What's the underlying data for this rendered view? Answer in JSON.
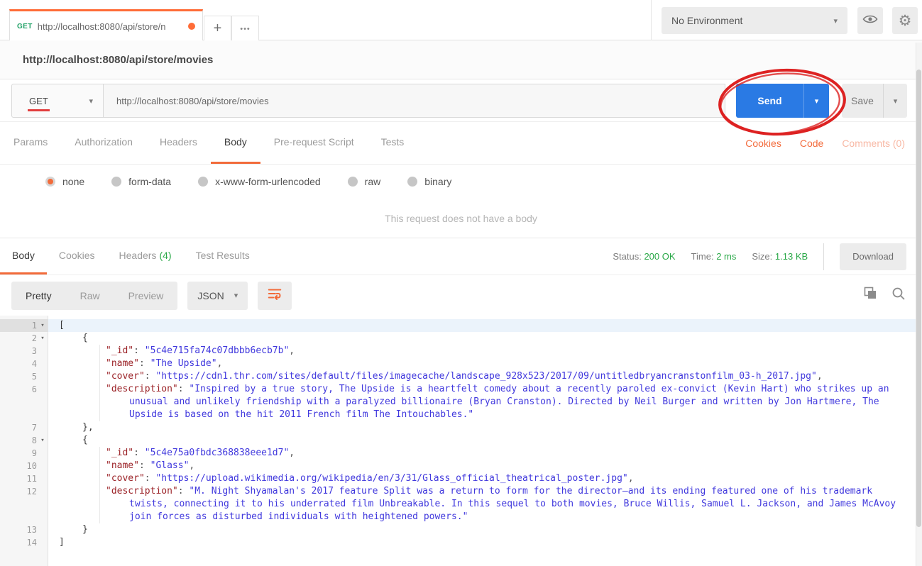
{
  "header": {
    "tab": {
      "method": "GET",
      "url": "http://localhost:8080/api/store/n"
    },
    "new_tab_label": "+",
    "more_tabs_label": "•••",
    "environment_label": "No Environment"
  },
  "request_title": "http://localhost:8080/api/store/movies",
  "request_builder": {
    "method": "GET",
    "url_value": "http://localhost:8080/api/store/movies",
    "send_label": "Send",
    "save_label": "Save"
  },
  "annotation": {
    "shape": "hand-drawn-ellipse",
    "color": "#dd2222",
    "target": "send-button"
  },
  "request_tabs": {
    "items": [
      "Params",
      "Authorization",
      "Headers",
      "Body",
      "Pre-request Script",
      "Tests"
    ],
    "active": "Body",
    "cookies_link": "Cookies",
    "code_link": "Code",
    "comments_link": "Comments (0)"
  },
  "body_type_options": [
    {
      "label": "none",
      "selected": true
    },
    {
      "label": "form-data",
      "selected": false
    },
    {
      "label": "x-www-form-urlencoded",
      "selected": false
    },
    {
      "label": "raw",
      "selected": false
    },
    {
      "label": "binary",
      "selected": false
    }
  ],
  "empty_body_message": "This request does not have a body",
  "response": {
    "tabs": {
      "body": "Body",
      "cookies": "Cookies",
      "headers": "Headers",
      "headers_count": "(4)",
      "test_results": "Test Results"
    },
    "active_tab": "Body",
    "meta": {
      "status_label": "Status:",
      "status_value": "200 OK",
      "time_label": "Time:",
      "time_value": "2 ms",
      "size_label": "Size:",
      "size_value": "1.13 KB"
    },
    "download_label": "Download",
    "view_modes": {
      "pretty": "Pretty",
      "raw": "Raw",
      "preview": "Preview"
    },
    "active_view": "Pretty",
    "format": "JSON"
  },
  "colors": {
    "accent_orange": "#ff6c37",
    "send_blue": "#2a7ae4",
    "method_green": "#23a268",
    "status_green": "#29a847",
    "link_orange": "#f36c3d",
    "annotation_red": "#dd2222",
    "json_key": "#9b2227",
    "json_string": "#4038dd"
  },
  "response_body": {
    "lines": [
      {
        "num": "1",
        "fold": true,
        "sel": true,
        "indent": 0,
        "parts": [
          {
            "c": "brk",
            "t": "["
          }
        ]
      },
      {
        "num": "2",
        "fold": true,
        "indent": 1,
        "parts": [
          {
            "c": "brk",
            "t": "{"
          }
        ]
      },
      {
        "num": "3",
        "indent": 2,
        "parts": [
          {
            "c": "key",
            "t": "\"_id\""
          },
          {
            "c": "pun",
            "t": ": "
          },
          {
            "c": "str",
            "t": "\"5c4e715fa74c07dbbb6ecb7b\""
          },
          {
            "c": "pun",
            "t": ","
          }
        ]
      },
      {
        "num": "4",
        "indent": 2,
        "parts": [
          {
            "c": "key",
            "t": "\"name\""
          },
          {
            "c": "pun",
            "t": ": "
          },
          {
            "c": "str",
            "t": "\"The Upside\""
          },
          {
            "c": "pun",
            "t": ","
          }
        ]
      },
      {
        "num": "5",
        "indent": 2,
        "parts": [
          {
            "c": "key",
            "t": "\"cover\""
          },
          {
            "c": "pun",
            "t": ": "
          },
          {
            "c": "str",
            "t": "\"https://cdn1.thr.com/sites/default/files/imagecache/landscape_928x523/2017/09/untitledbryancranstonfilm_03-h_2017.jpg\""
          },
          {
            "c": "pun",
            "t": ","
          }
        ]
      },
      {
        "num": "6",
        "indent": 2,
        "parts": [
          {
            "c": "key",
            "t": "\"description\""
          },
          {
            "c": "pun",
            "t": ": "
          },
          {
            "c": "str",
            "t": "\"Inspired by a true story, The Upside is a heartfelt comedy about a recently paroled ex-convict (Kevin Hart) who strikes up an unusual and unlikely friendship with a paralyzed billionaire (Bryan Cranston). Directed by Neil Burger and written by Jon Hartmere, The Upside is based on the hit 2011 French film The Intouchables.\""
          }
        ]
      },
      {
        "num": "7",
        "indent": 1,
        "parts": [
          {
            "c": "brk",
            "t": "},"
          }
        ]
      },
      {
        "num": "8",
        "fold": true,
        "indent": 1,
        "parts": [
          {
            "c": "brk",
            "t": "{"
          }
        ]
      },
      {
        "num": "9",
        "indent": 2,
        "parts": [
          {
            "c": "key",
            "t": "\"_id\""
          },
          {
            "c": "pun",
            "t": ": "
          },
          {
            "c": "str",
            "t": "\"5c4e75a0fbdc368838eee1d7\""
          },
          {
            "c": "pun",
            "t": ","
          }
        ]
      },
      {
        "num": "10",
        "indent": 2,
        "parts": [
          {
            "c": "key",
            "t": "\"name\""
          },
          {
            "c": "pun",
            "t": ": "
          },
          {
            "c": "str",
            "t": "\"Glass\""
          },
          {
            "c": "pun",
            "t": ","
          }
        ]
      },
      {
        "num": "11",
        "indent": 2,
        "parts": [
          {
            "c": "key",
            "t": "\"cover\""
          },
          {
            "c": "pun",
            "t": ": "
          },
          {
            "c": "str",
            "t": "\"https://upload.wikimedia.org/wikipedia/en/3/31/Glass_official_theatrical_poster.jpg\""
          },
          {
            "c": "pun",
            "t": ","
          }
        ]
      },
      {
        "num": "12",
        "indent": 2,
        "parts": [
          {
            "c": "key",
            "t": "\"description\""
          },
          {
            "c": "pun",
            "t": ": "
          },
          {
            "c": "str",
            "t": "\"M. Night Shyamalan's 2017 feature Split was a return to form for the director—and its ending featured one of his trademark twists, connecting it to his underrated film Unbreakable. In this sequel to both movies, Bruce Willis, Samuel L. Jackson, and James McAvoy join forces as disturbed individuals with heightened powers.\""
          }
        ]
      },
      {
        "num": "13",
        "indent": 1,
        "parts": [
          {
            "c": "brk",
            "t": "}"
          }
        ]
      },
      {
        "num": "14",
        "indent": 0,
        "parts": [
          {
            "c": "brk",
            "t": "]"
          }
        ]
      }
    ]
  }
}
